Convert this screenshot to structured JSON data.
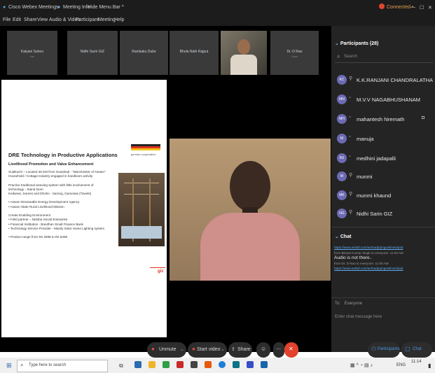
{
  "title_bar": {
    "app_name": "Cisco Webex Meetings",
    "meeting_info": "Meeting Info",
    "hide_menu": "Hide Menu Bar ^",
    "connected": "Connected •",
    "window_controls": [
      "—",
      "☐",
      "✕"
    ]
  },
  "menu": [
    "File",
    "Edit",
    "Share",
    "View",
    "Audio & Video",
    "Participant",
    "Meeting",
    "Help"
  ],
  "video_strip": [
    {
      "name": "Kalyani Sahoo",
      "sub": "me"
    },
    {
      "name": "Nidhi Sarin GIZ",
      "sub": ""
    },
    {
      "name": "Ramkaku Dube",
      "sub": ""
    },
    {
      "name": "Bhola Nath Rajput",
      "sub": ""
    },
    {
      "name": "",
      "sub": ""
    },
    {
      "name": "Dr. D Rao",
      "sub": "Host"
    }
  ],
  "slide": {
    "title": "DRE Technology in Productive Applications",
    "subtitle": "Livelihood Promotion and Value Enhancement",
    "logo_text": "german cooperation",
    "paragraphs": [
      "Sualkuchi – Located 35 KM from Guwahati - \"Manchester of Assam\"",
      "Household / Cottage Industry engaged in handloom activity",
      "",
      "Practice traditional weaving system with little involvement of",
      "technology - Stand loom",
      "Kedwear, Sarees and Dhoho - Sarong, Gamosas (Towels)",
      "",
      "• Assam Renewable Energy Development Agency",
      "• Assam State Rural Livelihood Mission",
      "",
      "Create Enabling Environment",
      "•  Field partner – Nidoba Social Enterprise",
      "•  Financial Institution - Bandhan Small Finance Bank",
      "•  Technology Service Provider - Mainly Solar Home Lighting system",
      "",
      "•  Product range from Rs 2599 to Rs 8499"
    ],
    "footer_logo": "giz"
  },
  "participants_panel": {
    "header": "Participants (28)",
    "search_placeholder": "Search",
    "list": [
      {
        "initials": "KC",
        "name": "K.K.RANJANI CHANDRALATHA"
      },
      {
        "initials": "MN",
        "name": "M.V.V NAGABHUSHANAM"
      },
      {
        "initials": "MH",
        "name": "mahantesh hiremath"
      },
      {
        "initials": "M",
        "name": "manuja"
      },
      {
        "initials": "MJ",
        "name": "medhini jadapalli"
      },
      {
        "initials": "M",
        "name": "munmi"
      },
      {
        "initials": "MK",
        "name": "munmi khaund"
      },
      {
        "initials": "NG",
        "name": "Nidhi Sarin GIZ"
      }
    ]
  },
  "chat": {
    "header": "Chat",
    "messages": [
      {
        "text": "https://www.wdsdl.com/arshadpq/ngowlines/ipub",
        "type": "link"
      },
      {
        "text": "from Bharat Kumar Singh to everyone: 11:03 AM",
        "type": "meta"
      },
      {
        "text": "Audio is not there..",
        "type": "body"
      },
      {
        "text": "from Dr. D Rao to everyone: 11:08 AM",
        "type": "meta"
      },
      {
        "text": "https://www.wdsdl.com/arshadpq/ngowlines/ipub",
        "type": "link"
      }
    ],
    "to_label": "To:",
    "to_value": "Everyone",
    "input_placeholder": "Enter chat message here"
  },
  "controls": {
    "unmute": "Unmute",
    "start_video": "Start video",
    "share": "Share",
    "participants_btn": "Participants",
    "chat_btn": "Chat"
  },
  "taskbar": {
    "search_placeholder": "Type here to search",
    "time": "11:14",
    "lang": "ENG"
  }
}
